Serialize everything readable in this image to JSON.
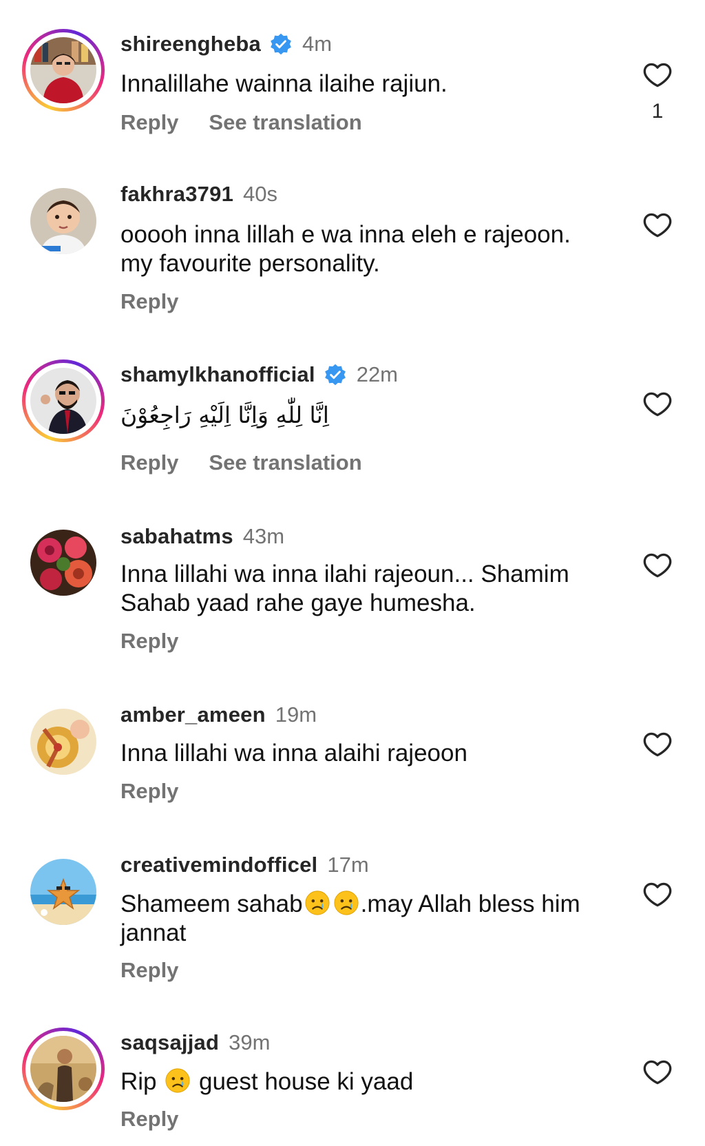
{
  "actions": {
    "reply_label": "Reply",
    "translate_label": "See translation"
  },
  "colors": {
    "verified": "#3897f0",
    "secondary_text": "#737373",
    "primary_text": "#111111"
  },
  "comments": [
    {
      "username": "shireengheba",
      "verified": true,
      "time": "4m",
      "text": "Innalillahe wainna ilaihe rajiun.",
      "likes": "1",
      "has_translation": true
    },
    {
      "username": "fakhra3791",
      "verified": false,
      "time": "40s",
      "text": "ooooh inna lillah e wa inna eleh e rajeoon. my favourite personality.",
      "likes": "",
      "has_translation": false
    },
    {
      "username": "shamylkhanofficial",
      "verified": true,
      "time": "22m",
      "text": "اِنَّا لِلّٰهِ وَاِنَّا اِلَيْهِ رَاجِعُوْنَ",
      "likes": "",
      "has_translation": true
    },
    {
      "username": "sabahatms",
      "verified": false,
      "time": "43m",
      "text": "Inna lillahi wa inna ilahi rajeoun... Shamim Sahab yaad rahe gaye humesha.",
      "likes": "",
      "has_translation": false
    },
    {
      "username": "amber_ameen",
      "verified": false,
      "time": "19m",
      "text": "Inna lillahi wa inna alaihi rajeoon",
      "likes": "",
      "has_translation": false
    },
    {
      "username": "creativemindofficel",
      "verified": false,
      "time": "17m",
      "text_before": "Shameem sahab",
      "text_after": ".may Allah bless him jannat",
      "emoji": "crying-face-emoji",
      "likes": "",
      "has_translation": false
    },
    {
      "username": "saqsajjad",
      "verified": false,
      "time": "39m",
      "text_before": "Rip ",
      "text_after": " guest house ki yaad",
      "emoji": "crying-face-emoji",
      "likes": "",
      "has_translation": false
    }
  ]
}
